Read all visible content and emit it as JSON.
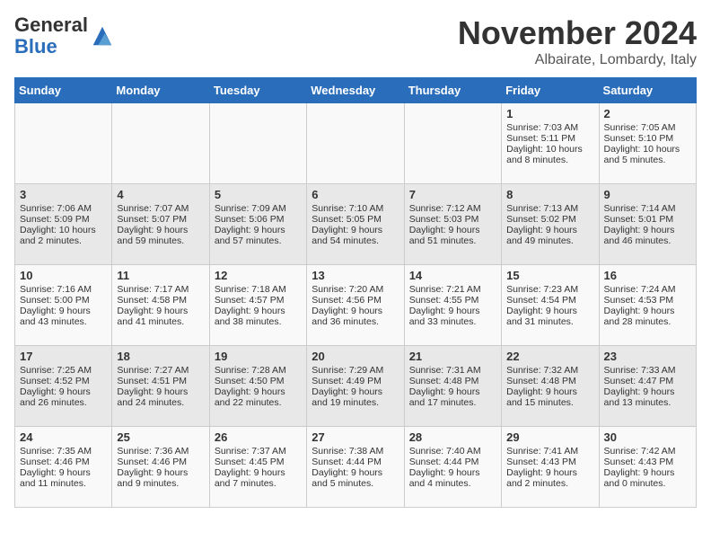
{
  "logo": {
    "general": "General",
    "blue": "Blue"
  },
  "title": "November 2024",
  "location": "Albairate, Lombardy, Italy",
  "headers": [
    "Sunday",
    "Monday",
    "Tuesday",
    "Wednesday",
    "Thursday",
    "Friday",
    "Saturday"
  ],
  "weeks": [
    [
      {
        "day": "",
        "info": ""
      },
      {
        "day": "",
        "info": ""
      },
      {
        "day": "",
        "info": ""
      },
      {
        "day": "",
        "info": ""
      },
      {
        "day": "",
        "info": ""
      },
      {
        "day": "1",
        "info": "Sunrise: 7:03 AM\nSunset: 5:11 PM\nDaylight: 10 hours and 8 minutes."
      },
      {
        "day": "2",
        "info": "Sunrise: 7:05 AM\nSunset: 5:10 PM\nDaylight: 10 hours and 5 minutes."
      }
    ],
    [
      {
        "day": "3",
        "info": "Sunrise: 7:06 AM\nSunset: 5:09 PM\nDaylight: 10 hours and 2 minutes."
      },
      {
        "day": "4",
        "info": "Sunrise: 7:07 AM\nSunset: 5:07 PM\nDaylight: 9 hours and 59 minutes."
      },
      {
        "day": "5",
        "info": "Sunrise: 7:09 AM\nSunset: 5:06 PM\nDaylight: 9 hours and 57 minutes."
      },
      {
        "day": "6",
        "info": "Sunrise: 7:10 AM\nSunset: 5:05 PM\nDaylight: 9 hours and 54 minutes."
      },
      {
        "day": "7",
        "info": "Sunrise: 7:12 AM\nSunset: 5:03 PM\nDaylight: 9 hours and 51 minutes."
      },
      {
        "day": "8",
        "info": "Sunrise: 7:13 AM\nSunset: 5:02 PM\nDaylight: 9 hours and 49 minutes."
      },
      {
        "day": "9",
        "info": "Sunrise: 7:14 AM\nSunset: 5:01 PM\nDaylight: 9 hours and 46 minutes."
      }
    ],
    [
      {
        "day": "10",
        "info": "Sunrise: 7:16 AM\nSunset: 5:00 PM\nDaylight: 9 hours and 43 minutes."
      },
      {
        "day": "11",
        "info": "Sunrise: 7:17 AM\nSunset: 4:58 PM\nDaylight: 9 hours and 41 minutes."
      },
      {
        "day": "12",
        "info": "Sunrise: 7:18 AM\nSunset: 4:57 PM\nDaylight: 9 hours and 38 minutes."
      },
      {
        "day": "13",
        "info": "Sunrise: 7:20 AM\nSunset: 4:56 PM\nDaylight: 9 hours and 36 minutes."
      },
      {
        "day": "14",
        "info": "Sunrise: 7:21 AM\nSunset: 4:55 PM\nDaylight: 9 hours and 33 minutes."
      },
      {
        "day": "15",
        "info": "Sunrise: 7:23 AM\nSunset: 4:54 PM\nDaylight: 9 hours and 31 minutes."
      },
      {
        "day": "16",
        "info": "Sunrise: 7:24 AM\nSunset: 4:53 PM\nDaylight: 9 hours and 28 minutes."
      }
    ],
    [
      {
        "day": "17",
        "info": "Sunrise: 7:25 AM\nSunset: 4:52 PM\nDaylight: 9 hours and 26 minutes."
      },
      {
        "day": "18",
        "info": "Sunrise: 7:27 AM\nSunset: 4:51 PM\nDaylight: 9 hours and 24 minutes."
      },
      {
        "day": "19",
        "info": "Sunrise: 7:28 AM\nSunset: 4:50 PM\nDaylight: 9 hours and 22 minutes."
      },
      {
        "day": "20",
        "info": "Sunrise: 7:29 AM\nSunset: 4:49 PM\nDaylight: 9 hours and 19 minutes."
      },
      {
        "day": "21",
        "info": "Sunrise: 7:31 AM\nSunset: 4:48 PM\nDaylight: 9 hours and 17 minutes."
      },
      {
        "day": "22",
        "info": "Sunrise: 7:32 AM\nSunset: 4:48 PM\nDaylight: 9 hours and 15 minutes."
      },
      {
        "day": "23",
        "info": "Sunrise: 7:33 AM\nSunset: 4:47 PM\nDaylight: 9 hours and 13 minutes."
      }
    ],
    [
      {
        "day": "24",
        "info": "Sunrise: 7:35 AM\nSunset: 4:46 PM\nDaylight: 9 hours and 11 minutes."
      },
      {
        "day": "25",
        "info": "Sunrise: 7:36 AM\nSunset: 4:46 PM\nDaylight: 9 hours and 9 minutes."
      },
      {
        "day": "26",
        "info": "Sunrise: 7:37 AM\nSunset: 4:45 PM\nDaylight: 9 hours and 7 minutes."
      },
      {
        "day": "27",
        "info": "Sunrise: 7:38 AM\nSunset: 4:44 PM\nDaylight: 9 hours and 5 minutes."
      },
      {
        "day": "28",
        "info": "Sunrise: 7:40 AM\nSunset: 4:44 PM\nDaylight: 9 hours and 4 minutes."
      },
      {
        "day": "29",
        "info": "Sunrise: 7:41 AM\nSunset: 4:43 PM\nDaylight: 9 hours and 2 minutes."
      },
      {
        "day": "30",
        "info": "Sunrise: 7:42 AM\nSunset: 4:43 PM\nDaylight: 9 hours and 0 minutes."
      }
    ]
  ]
}
